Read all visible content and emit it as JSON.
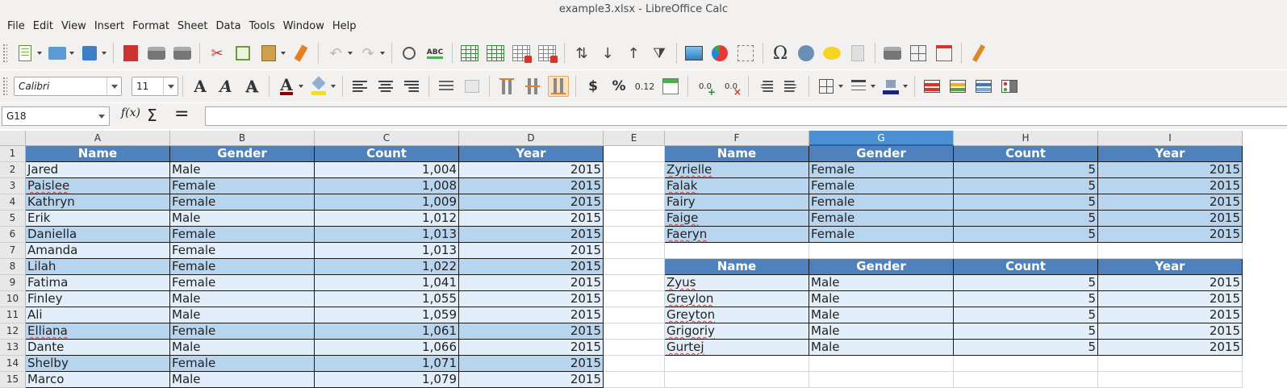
{
  "window": {
    "title": "example3.xlsx - LibreOffice Calc"
  },
  "menu": [
    "File",
    "Edit",
    "View",
    "Insert",
    "Format",
    "Sheet",
    "Data",
    "Tools",
    "Window",
    "Help"
  ],
  "toolbar_standard": {
    "icons": [
      "new-document-icon",
      "open-folder-icon",
      "save-icon",
      "export-pdf-icon",
      "print-icon",
      "print-preview-icon",
      "cut-icon",
      "copy-icon",
      "paste-icon",
      "clone-formatting-icon",
      "undo-icon",
      "redo-icon",
      "find-replace-icon",
      "spellcheck-icon",
      "row-icon",
      "column-icon",
      "delete-rows-icon",
      "delete-columns-icon",
      "sort-icon",
      "sort-descending-icon",
      "sort-ascending-icon",
      "autofilter-icon",
      "insert-image-icon",
      "insert-chart-icon",
      "pivot-table-icon",
      "special-character-icon",
      "hyperlink-icon",
      "comment-icon",
      "headers-footers-icon",
      "define-print-area-icon",
      "freeze-rows-columns-icon",
      "split-window-icon",
      "show-draw-functions-icon"
    ],
    "spellcheck_label": "ABC"
  },
  "toolbar_format": {
    "font_name": "Calibri",
    "font_size": "11",
    "bold": "A",
    "italic": "A",
    "shadow": "A",
    "font_color": "A",
    "currency": "$",
    "percent": "%",
    "number": "0.12",
    "add_decimal": "0.0",
    "delete_decimal": "0.0",
    "colors": {
      "font_color": "#8b0000",
      "highlight": "#f2e600",
      "border_color": "#1a237e"
    }
  },
  "formula_bar": {
    "name_box": "G18",
    "fx": "f(x)",
    "sum": "Σ",
    "equals": "=",
    "formula": ""
  },
  "columns": [
    {
      "id": "A",
      "label": "A"
    },
    {
      "id": "B",
      "label": "B"
    },
    {
      "id": "C",
      "label": "C"
    },
    {
      "id": "D",
      "label": "D"
    },
    {
      "id": "E",
      "label": "E"
    },
    {
      "id": "F",
      "label": "F"
    },
    {
      "id": "G",
      "label": "G",
      "selected": true
    },
    {
      "id": "H",
      "label": "H"
    },
    {
      "id": "I",
      "label": "I"
    }
  ],
  "row_numbers": [
    "1",
    "2",
    "3",
    "4",
    "5",
    "6",
    "7",
    "8",
    "9",
    "10",
    "11",
    "12",
    "13",
    "14",
    "15"
  ],
  "table_main": {
    "headers": [
      "Name",
      "Gender",
      "Count",
      "Year"
    ],
    "rows": [
      [
        "Jared",
        "Male",
        "1,004",
        "2015"
      ],
      [
        "Paislee",
        "Female",
        "1,008",
        "2015"
      ],
      [
        "Kathryn",
        "Female",
        "1,009",
        "2015"
      ],
      [
        "Erik",
        "Male",
        "1,012",
        "2015"
      ],
      [
        "Daniella",
        "Female",
        "1,013",
        "2015"
      ],
      [
        "Amanda",
        "Female",
        "1,013",
        "2015"
      ],
      [
        "Lilah",
        "Female",
        "1,022",
        "2015"
      ],
      [
        "Fatima",
        "Female",
        "1,041",
        "2015"
      ],
      [
        "Finley",
        "Male",
        "1,055",
        "2015"
      ],
      [
        "Ali",
        "Male",
        "1,059",
        "2015"
      ],
      [
        "Elliana",
        "Female",
        "1,061",
        "2015"
      ],
      [
        "Dante",
        "Male",
        "1,066",
        "2015"
      ],
      [
        "Shelby",
        "Female",
        "1,071",
        "2015"
      ],
      [
        "Marco",
        "Male",
        "1,079",
        "2015"
      ]
    ]
  },
  "table_female": {
    "headers": [
      "Name",
      "Gender",
      "Count",
      "Year"
    ],
    "rows": [
      [
        "Zyrielle",
        "Female",
        "5",
        "2015"
      ],
      [
        "Falak",
        "Female",
        "5",
        "2015"
      ],
      [
        "Fairy",
        "Female",
        "5",
        "2015"
      ],
      [
        "Faige",
        "Female",
        "5",
        "2015"
      ],
      [
        "Faeryn",
        "Female",
        "5",
        "2015"
      ]
    ]
  },
  "table_male": {
    "headers": [
      "Name",
      "Gender",
      "Count",
      "Year"
    ],
    "rows": [
      [
        "Zyus",
        "Male",
        "5",
        "2015"
      ],
      [
        "Greylon",
        "Male",
        "5",
        "2015"
      ],
      [
        "Greyton",
        "Male",
        "5",
        "2015"
      ],
      [
        "Grigoriy",
        "Male",
        "5",
        "2015"
      ],
      [
        "Gurtej",
        "Male",
        "5",
        "2015"
      ]
    ]
  },
  "theme": {
    "header_fill": "#4f81bd",
    "band_dark": "#b8d5f0",
    "band_light": "#e2eef9",
    "selected_column": "#4c90d4"
  }
}
